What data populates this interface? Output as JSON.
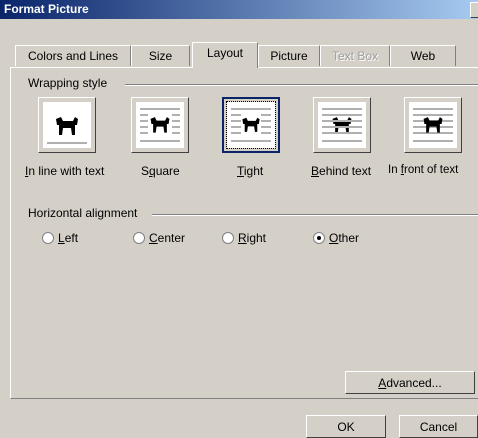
{
  "window": {
    "title": "Format Picture"
  },
  "tabs": [
    {
      "label": "Colors and Lines"
    },
    {
      "label": "Size"
    },
    {
      "label": "Layout"
    },
    {
      "label": "Picture"
    },
    {
      "label": "Text Box"
    },
    {
      "label": "Web"
    }
  ],
  "active_tab": "Layout",
  "wrapping": {
    "group_label": "Wrapping style",
    "options": [
      {
        "label_pre": "",
        "label_u": "I",
        "label_post": "n line with text"
      },
      {
        "label_pre": "S",
        "label_u": "q",
        "label_post": "uare"
      },
      {
        "label_pre": "",
        "label_u": "T",
        "label_post": "ight"
      },
      {
        "label_pre": "",
        "label_u": "B",
        "label_post": "ehind text"
      },
      {
        "label_pre": "In ",
        "label_u": "f",
        "label_post": "ront of text"
      }
    ],
    "selected": "Tight"
  },
  "alignment": {
    "group_label": "Horizontal alignment",
    "options": [
      {
        "label_u": "L",
        "label_post": "eft"
      },
      {
        "label_u": "C",
        "label_post": "enter"
      },
      {
        "label_u": "R",
        "label_post": "ight"
      },
      {
        "label_u": "O",
        "label_post": "ther"
      }
    ],
    "selected": "Other"
  },
  "buttons": {
    "advanced_u": "A",
    "advanced_post": "dvanced...",
    "ok": "OK",
    "cancel": "Cancel"
  },
  "colors": {
    "titlebar": "#0a246a",
    "face": "#d4d0c8",
    "selection": "#0a246a"
  },
  "icons": {
    "wrap_preview": "dog-silhouette-icon"
  }
}
